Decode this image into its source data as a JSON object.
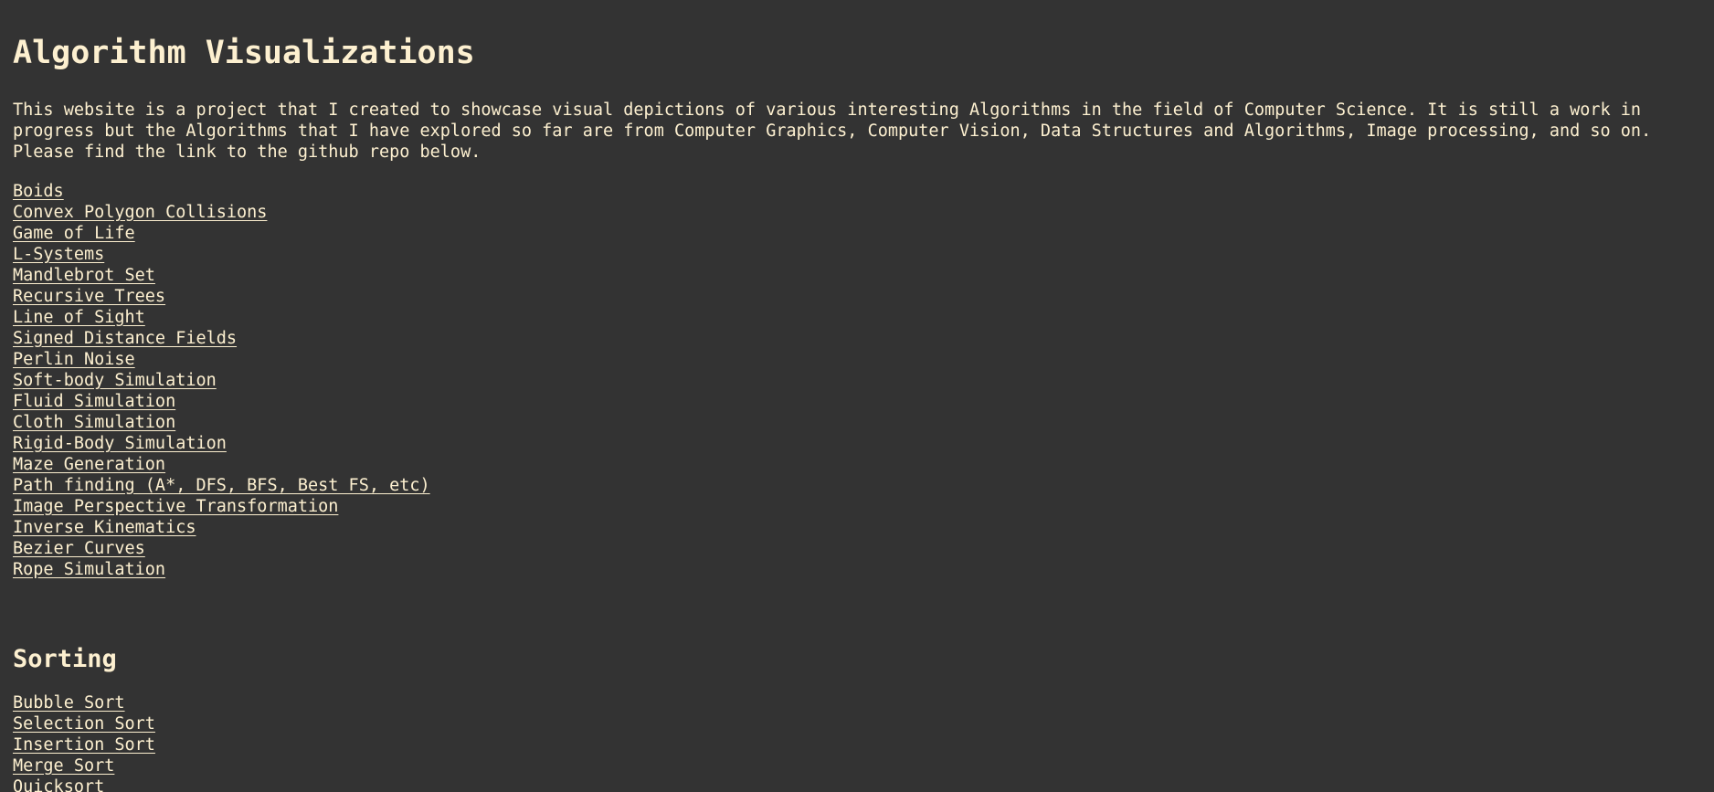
{
  "header": {
    "title": "Algorithm Visualizations"
  },
  "intro": {
    "text": "This website is a project that I created to showcase visual depictions of various interesting Algorithms in the field of Computer Science. It is still a work in progress but the Algorithms that I have explored so far are from Computer Graphics, Computer Vision, Data Structures and Algorithms, Image processing, and so on. Please find the link to the github repo below."
  },
  "algorithms": {
    "items": [
      "Boids",
      "Convex Polygon Collisions",
      "Game of Life",
      "L-Systems",
      "Mandlebrot Set",
      "Recursive Trees",
      "Line of Sight",
      "Signed Distance Fields",
      "Perlin Noise",
      "Soft-body Simulation",
      "Fluid Simulation",
      "Cloth Simulation",
      "Rigid-Body Simulation",
      "Maze Generation",
      "Path finding (A*, DFS, BFS, Best FS, etc)",
      "Image Perspective Transformation",
      "Inverse Kinematics",
      "Bezier Curves",
      "Rope Simulation"
    ]
  },
  "sorting": {
    "title": "Sorting",
    "items": [
      "Bubble Sort",
      "Selection Sort",
      "Insertion Sort",
      "Merge Sort",
      "Quicksort"
    ]
  },
  "colors": {
    "background": "#333333",
    "text": "#fdf0d0"
  }
}
